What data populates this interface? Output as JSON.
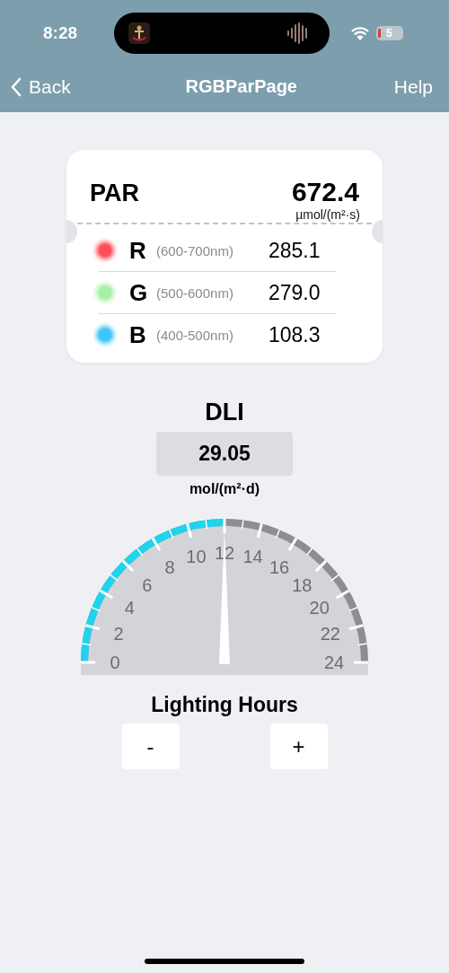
{
  "status_bar": {
    "time": "8:28",
    "battery": "5"
  },
  "nav": {
    "back": "Back",
    "title": "RGBParPage",
    "help": "Help"
  },
  "par": {
    "label": "PAR",
    "value": "672.4",
    "unit": "µmol/(m²·s)",
    "channels": [
      {
        "letter": "R",
        "range": "(600-700nm)",
        "value": "285.1",
        "color": "#ff4f5a"
      },
      {
        "letter": "G",
        "range": "(500-600nm)",
        "value": "279.0",
        "color": "#a6f0a6"
      },
      {
        "letter": "B",
        "range": "(400-500nm)",
        "value": "108.3",
        "color": "#3ec6fa"
      }
    ]
  },
  "dli": {
    "title": "DLI",
    "value": "29.05",
    "unit": "mol/(m²·d)"
  },
  "gauge": {
    "level": 0.5,
    "labels": [
      "0",
      "2",
      "4",
      "6",
      "8",
      "10",
      "12",
      "14",
      "16",
      "18",
      "20",
      "22",
      "24"
    ]
  },
  "lighting_hours": {
    "title": "Lighting Hours",
    "buttons": [
      "-",
      "+"
    ]
  }
}
